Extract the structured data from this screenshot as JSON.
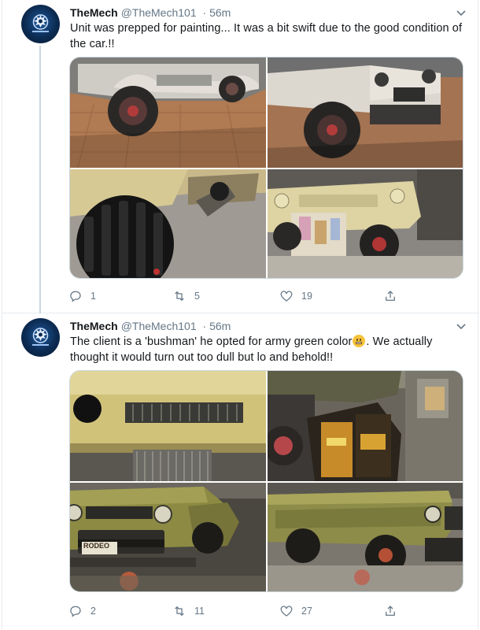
{
  "tweets": [
    {
      "name": "TheMech",
      "handle": "@TheMech101",
      "time": "· 56m",
      "text": "Unit was prepped for painting... It was a bit swift due to the good condition of the car.!!",
      "actions": {
        "replies": "1",
        "retweets": "5",
        "likes": "19"
      },
      "icons": [
        "reply-icon",
        "retweet-icon",
        "like-icon",
        "share-icon"
      ]
    },
    {
      "name": "TheMech",
      "handle": "@TheMech101",
      "time": "· 56m",
      "text_before_emoji": "The client is a 'bushman' he opted for army green color",
      "text_after_emoji": ". We actually thought it would turn out too dull but lo and behold!!",
      "actions": {
        "replies": "2",
        "retweets": "11",
        "likes": "27"
      },
      "icons": [
        "reply-icon",
        "retweet-icon",
        "like-icon",
        "share-icon"
      ]
    }
  ],
  "photo_text": {
    "bumper_plate": "RODEO"
  },
  "colors": {
    "text": "#14171a",
    "secondary": "#657786",
    "border": "#e6ecf0",
    "cream_primer": "#d9cf8f",
    "army_green": "#8a8a3e"
  }
}
